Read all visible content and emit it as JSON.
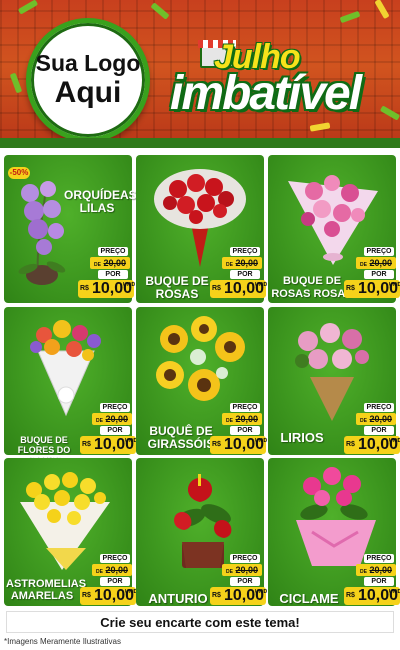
{
  "header": {
    "logo_line1": "Sua Logo",
    "logo_line2": "Aqui",
    "title_line1": "Julho",
    "title_line2": "imbatível"
  },
  "price_labels": {
    "preco": "PREÇO",
    "de": "DE",
    "por": "POR",
    "currency": "R$",
    "unit": "UNID"
  },
  "products": [
    {
      "name": "ORQUÍDEAS LILAS",
      "old_price": "20,00",
      "new_price": "10,00",
      "badge": "-50%"
    },
    {
      "name": "BUQUE DE ROSAS",
      "old_price": "20,00",
      "new_price": "10,00"
    },
    {
      "name": "BUQUE DE ROSAS ROSAS",
      "old_price": "20,00",
      "new_price": "10,00"
    },
    {
      "name": "BUQUE DE FLORES DO CAMPO",
      "old_price": "20,00",
      "new_price": "10,00"
    },
    {
      "name": "BUQUÊ DE GIRASSÓIS",
      "old_price": "20,00",
      "new_price": "10,00"
    },
    {
      "name": "LIRIOS",
      "old_price": "20,00",
      "new_price": "10,00"
    },
    {
      "name": "ASTROMELIAS AMARELAS",
      "old_price": "20,00",
      "new_price": "10,00"
    },
    {
      "name": "ANTURIO",
      "old_price": "20,00",
      "new_price": "10,00"
    },
    {
      "name": "CICLAME",
      "old_price": "20,00",
      "new_price": "10,00"
    }
  ],
  "footer": {
    "cta": "Crie seu encarte com este tema!",
    "disclaimer": "*Imagens Meramente Ilustrativas"
  }
}
